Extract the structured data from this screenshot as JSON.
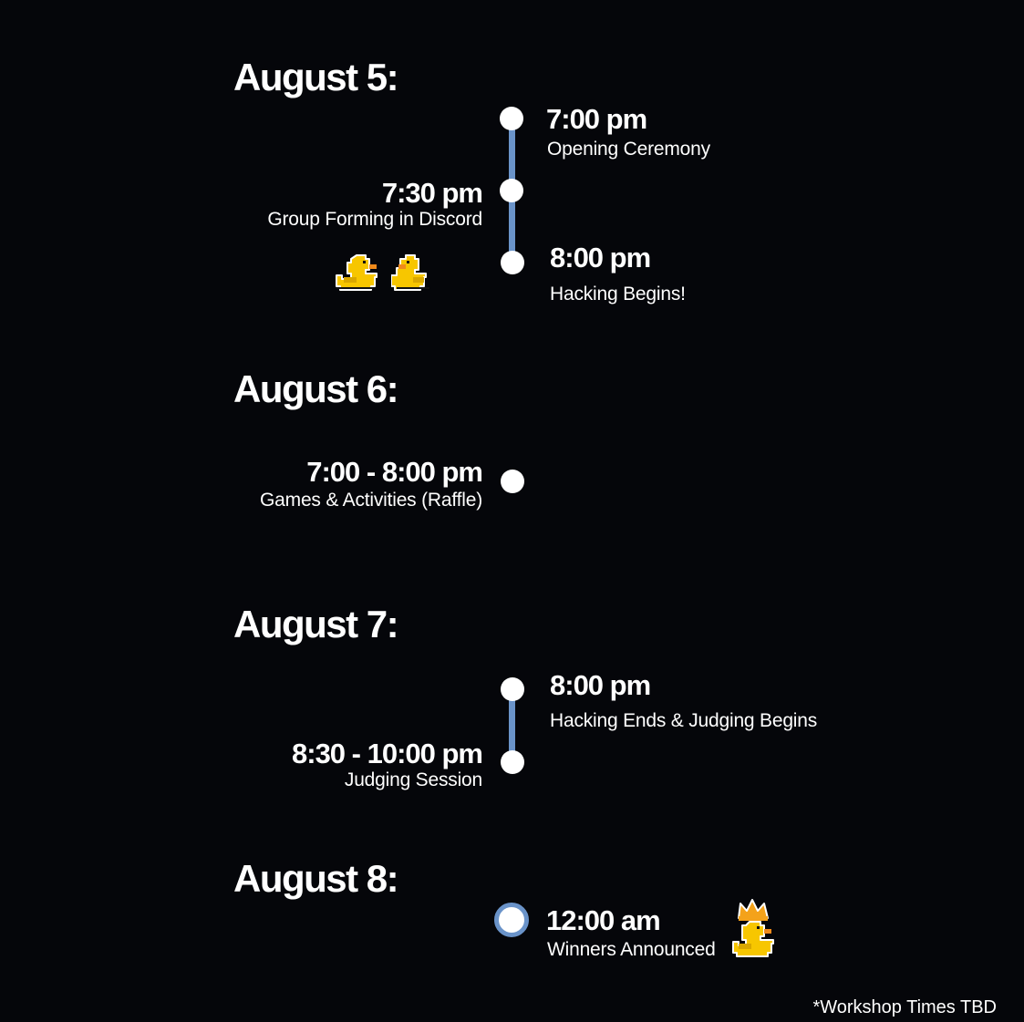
{
  "days": [
    {
      "title": "August 5:",
      "events": [
        {
          "time": "7:00 pm",
          "desc": "Opening Ceremony"
        },
        {
          "time": "7:30 pm",
          "desc": "Group Forming in Discord"
        },
        {
          "time": "8:00 pm",
          "desc": "Hacking Begins!"
        }
      ]
    },
    {
      "title": "August 6:",
      "events": [
        {
          "time": "7:00 - 8:00  pm",
          "desc": "Games & Activities (Raffle)"
        }
      ]
    },
    {
      "title": "August 7:",
      "events": [
        {
          "time": "8:00 pm",
          "desc": "Hacking Ends & Judging Begins"
        },
        {
          "time": "8:30 - 10:00 pm",
          "desc": "Judging Session"
        }
      ]
    },
    {
      "title": "August 8:",
      "events": [
        {
          "time": "12:00 am",
          "desc": "Winners Announced"
        }
      ]
    }
  ],
  "footnote": "*Workshop Times TBD",
  "colors": {
    "background": "#05060a",
    "timeline": "#6a93c9",
    "duck": "#f7c600",
    "crown": "#f4a21a"
  },
  "icons": [
    "duck-icon",
    "duck-icon",
    "crowned-duck-icon"
  ]
}
